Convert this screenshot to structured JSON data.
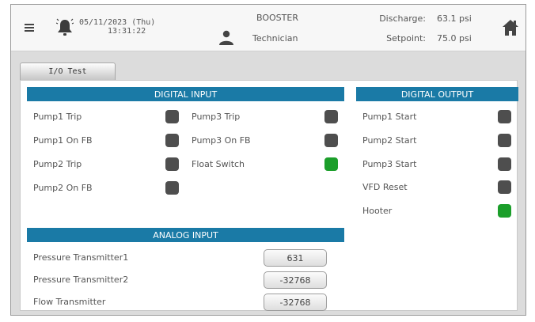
{
  "header": {
    "date": "05/11/2023 (Thu)",
    "time": "13:31:22",
    "station": "BOOSTER",
    "role": "Technician",
    "discharge_label": "Discharge:",
    "discharge_value": "63.1 psi",
    "setpoint_label": "Setpoint:",
    "setpoint_value": "75.0 psi"
  },
  "tab": {
    "label": "I/O Test"
  },
  "digital_input": {
    "title": "DIGITAL INPUT",
    "left": [
      {
        "label": "Pump1 Trip",
        "state": "off"
      },
      {
        "label": "Pump1 On FB",
        "state": "off"
      },
      {
        "label": "Pump2 Trip",
        "state": "off"
      },
      {
        "label": "Pump2 On FB",
        "state": "off"
      }
    ],
    "right": [
      {
        "label": "Pump3 Trip",
        "state": "off"
      },
      {
        "label": "Pump3 On FB",
        "state": "off"
      },
      {
        "label": "Float Switch",
        "state": "on"
      }
    ]
  },
  "digital_output": {
    "title": "DIGITAL OUTPUT",
    "items": [
      {
        "label": "Pump1 Start",
        "state": "off"
      },
      {
        "label": "Pump2 Start",
        "state": "off"
      },
      {
        "label": "Pump3 Start",
        "state": "off"
      },
      {
        "label": "VFD Reset",
        "state": "off"
      },
      {
        "label": "Hooter",
        "state": "on"
      }
    ]
  },
  "analog_input": {
    "title": "ANALOG INPUT",
    "items": [
      {
        "label": "Pressure Transmitter1",
        "value": "631"
      },
      {
        "label": "Pressure Transmitter2",
        "value": "-32768"
      },
      {
        "label": "Flow Transmitter",
        "value": "-32768"
      }
    ]
  },
  "colors": {
    "section_bar": "#1a7aa6",
    "led_off": "#4e4e4e",
    "led_on": "#1b9e2a"
  },
  "icons": [
    "menu-icon",
    "alarm-bell-icon",
    "user-icon",
    "home-icon"
  ]
}
